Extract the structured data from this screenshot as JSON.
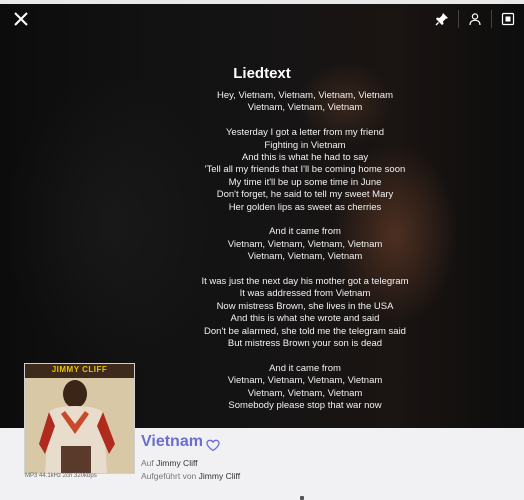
{
  "lyrics": {
    "title": "Liedtext",
    "stanzas": [
      [
        "Hey, Vietnam, Vietnam, Vietnam, Vietnam",
        "Vietnam, Vietnam, Vietnam"
      ],
      [
        "Yesterday I got a letter from my friend",
        "Fighting in Vietnam",
        "And this is what he had to say",
        "'Tell all my friends that I'll be coming home soon",
        "My time it'll be up some time in June",
        "Don't forget, he said to tell my sweet Mary",
        "Her golden lips as sweet as cherries"
      ],
      [
        "And it came from",
        "Vietnam, Vietnam, Vietnam, Vietnam",
        "Vietnam, Vietnam, Vietnam"
      ],
      [
        "It was just the next day his mother got a telegram",
        "It was addressed from Vietnam",
        "Now mistress Brown, she lives in the USA",
        "And this is what she wrote and said",
        "Don't be alarmed, she told me the telegram said",
        "But mistress Brown your son is dead"
      ],
      [
        "And it came from",
        "Vietnam, Vietnam, Vietnam, Vietnam",
        "Vietnam, Vietnam, Vietnam",
        "Somebody please stop that war now"
      ]
    ]
  },
  "icons": {
    "close": "close-icon",
    "pin": "pin-icon",
    "user": "user-icon",
    "screen": "screen-icon",
    "heart": "heart-icon"
  },
  "player": {
    "album_cover_text": "JIMMY CLIFF",
    "quality": "MP3  44.1kHz 2ch  320kbps",
    "song_title": "Vietnam",
    "album_prefix": "Auf",
    "album": "Jimmy Cliff",
    "artist_prefix": "Aufgeführt von",
    "artist": "Jimmy Cliff"
  },
  "colors": {
    "title_accent": "#6b6ed0",
    "background": "#0b0b0b",
    "player_bg": "#f1f1f3"
  }
}
